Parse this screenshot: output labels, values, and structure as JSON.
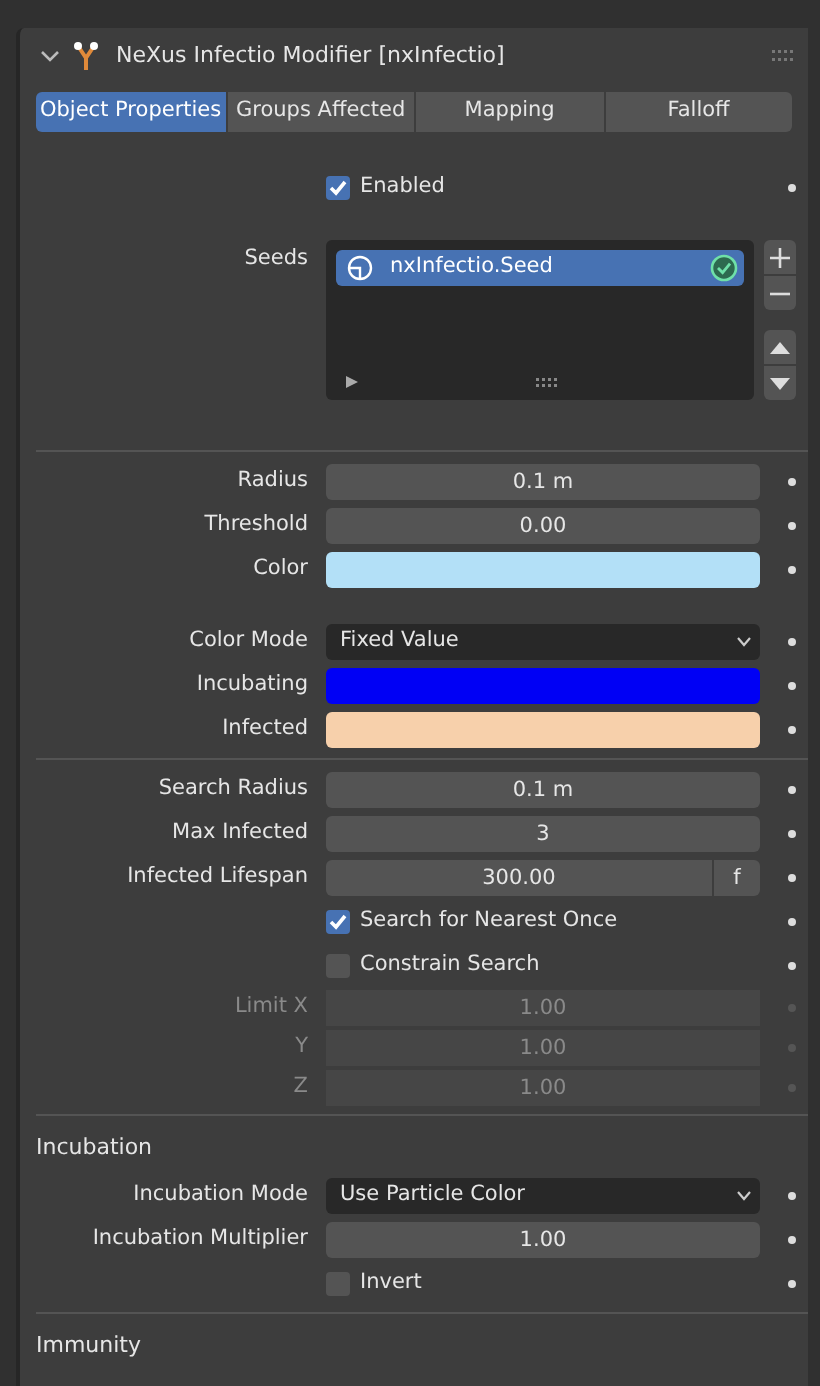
{
  "header": {
    "title": "NeXus Infectio Modifier [nxInfectio]",
    "expanded": true
  },
  "tabs": [
    {
      "label": "Object Properties",
      "selected": true
    },
    {
      "label": "Groups Affected",
      "selected": false
    },
    {
      "label": "Mapping",
      "selected": false
    },
    {
      "label": "Falloff",
      "selected": false
    }
  ],
  "rows": [
    {
      "kind": "checkbox",
      "label": "Enabled",
      "checked": true,
      "disabled": false
    },
    {
      "kind": "list",
      "label": "Seeds",
      "items": [
        {
          "label": "nxInfectio.Seed",
          "selected": true
        }
      ]
    },
    {
      "kind": "divider"
    },
    {
      "kind": "number",
      "label": "Radius",
      "value": "0.1 m",
      "disabled": false
    },
    {
      "kind": "number",
      "label": "Threshold",
      "value": "0.00",
      "disabled": false
    },
    {
      "kind": "color",
      "label": "Color",
      "color": "#b3e0f7"
    },
    {
      "kind": "gap"
    },
    {
      "kind": "dropdown",
      "label": "Color Mode",
      "value": "Fixed Value"
    },
    {
      "kind": "color",
      "label": "Incubating",
      "color": "#0000f5"
    },
    {
      "kind": "color",
      "label": "Infected",
      "color": "#f7d0ab"
    },
    {
      "kind": "divider"
    },
    {
      "kind": "number",
      "label": "Search Radius",
      "value": "0.1 m",
      "disabled": false
    },
    {
      "kind": "number",
      "label": "Max Infected",
      "value": "3",
      "disabled": false
    },
    {
      "kind": "number",
      "label": "Infected Lifespan",
      "value": "300.00",
      "suffix": "f",
      "disabled": false
    },
    {
      "kind": "checkbox",
      "label": "Search for Nearest Once",
      "checked": true,
      "disabled": false
    },
    {
      "kind": "checkbox",
      "label": "Constrain Search",
      "checked": false,
      "disabled": false
    },
    {
      "kind": "number",
      "label": "Limit X",
      "value": "1.00",
      "disabled": true
    },
    {
      "kind": "number",
      "label": "Y",
      "value": "1.00",
      "disabled": true
    },
    {
      "kind": "number",
      "label": "Z",
      "value": "1.00",
      "disabled": true
    },
    {
      "kind": "divider"
    },
    {
      "kind": "section",
      "label": "Incubation"
    },
    {
      "kind": "dropdown",
      "label": "Incubation Mode",
      "value": "Use Particle Color"
    },
    {
      "kind": "number",
      "label": "Incubation Multiplier",
      "value": "1.00",
      "disabled": false
    },
    {
      "kind": "checkbox",
      "label": "Invert",
      "checked": false,
      "disabled": false
    },
    {
      "kind": "divider"
    },
    {
      "kind": "section",
      "label": "Immunity"
    }
  ]
}
